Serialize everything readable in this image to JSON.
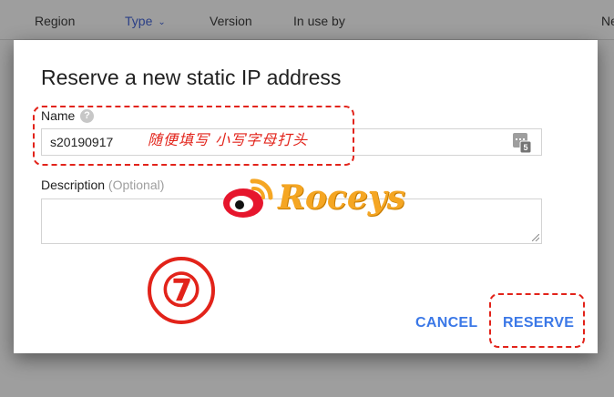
{
  "background_table": {
    "columns": [
      {
        "label": "Region"
      },
      {
        "label": "Type"
      },
      {
        "label": "Version"
      },
      {
        "label": "In use by"
      },
      {
        "label": "Ne"
      }
    ]
  },
  "dialog": {
    "title": "Reserve a new static IP address",
    "name_label": "Name",
    "name_value": "s20190917",
    "description_label": "Description",
    "description_optional": "(Optional)",
    "description_value": "",
    "cancel_label": "CANCEL",
    "reserve_label": "RESERVE"
  },
  "annotations": {
    "name_note": "随便填写 小写字母打头",
    "step_number": "⑦",
    "watermark": "Roceys",
    "accent_color": "#e2231a"
  },
  "colors": {
    "button_blue": "#3b78e7",
    "overlay": "#9e9e9e"
  }
}
